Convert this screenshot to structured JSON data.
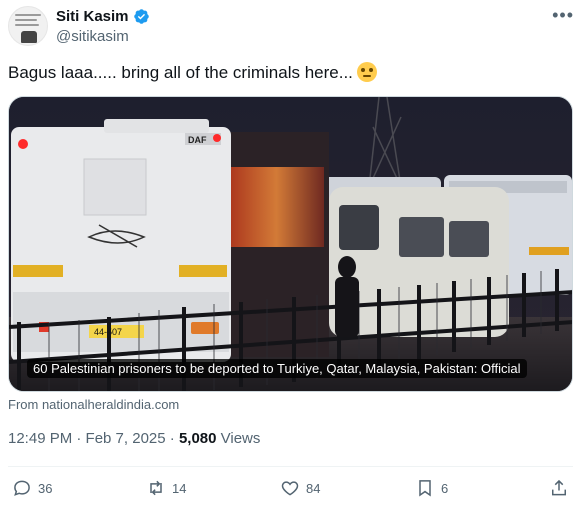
{
  "author": {
    "display_name": "Siti Kasim",
    "handle": "@sitikasim",
    "verified": true,
    "avatar_icon": "avatar-image"
  },
  "tweet": {
    "text": "Bagus laaa..... bring all of the criminals here...",
    "emoji_icon": "face-with-rolling-eyes-icon"
  },
  "media": {
    "caption": "60 Palestinian prisoners to be deported to Turkiye, Qatar, Malaysia, Pakistan: Official",
    "bus_brand": "DAF",
    "plate": "44-507",
    "source": "From nationalheraldindia.com"
  },
  "meta": {
    "time_date": "12:49 PM · Feb 7, 2025 · ",
    "views_count": "5,080",
    "views_label": " Views"
  },
  "actions": {
    "replies": "36",
    "reposts": "14",
    "likes": "84",
    "bookmarks": "6"
  },
  "colors": {
    "verified": "#1d9bf0",
    "secondary_text": "#536471",
    "primary_text": "#0f1419"
  }
}
